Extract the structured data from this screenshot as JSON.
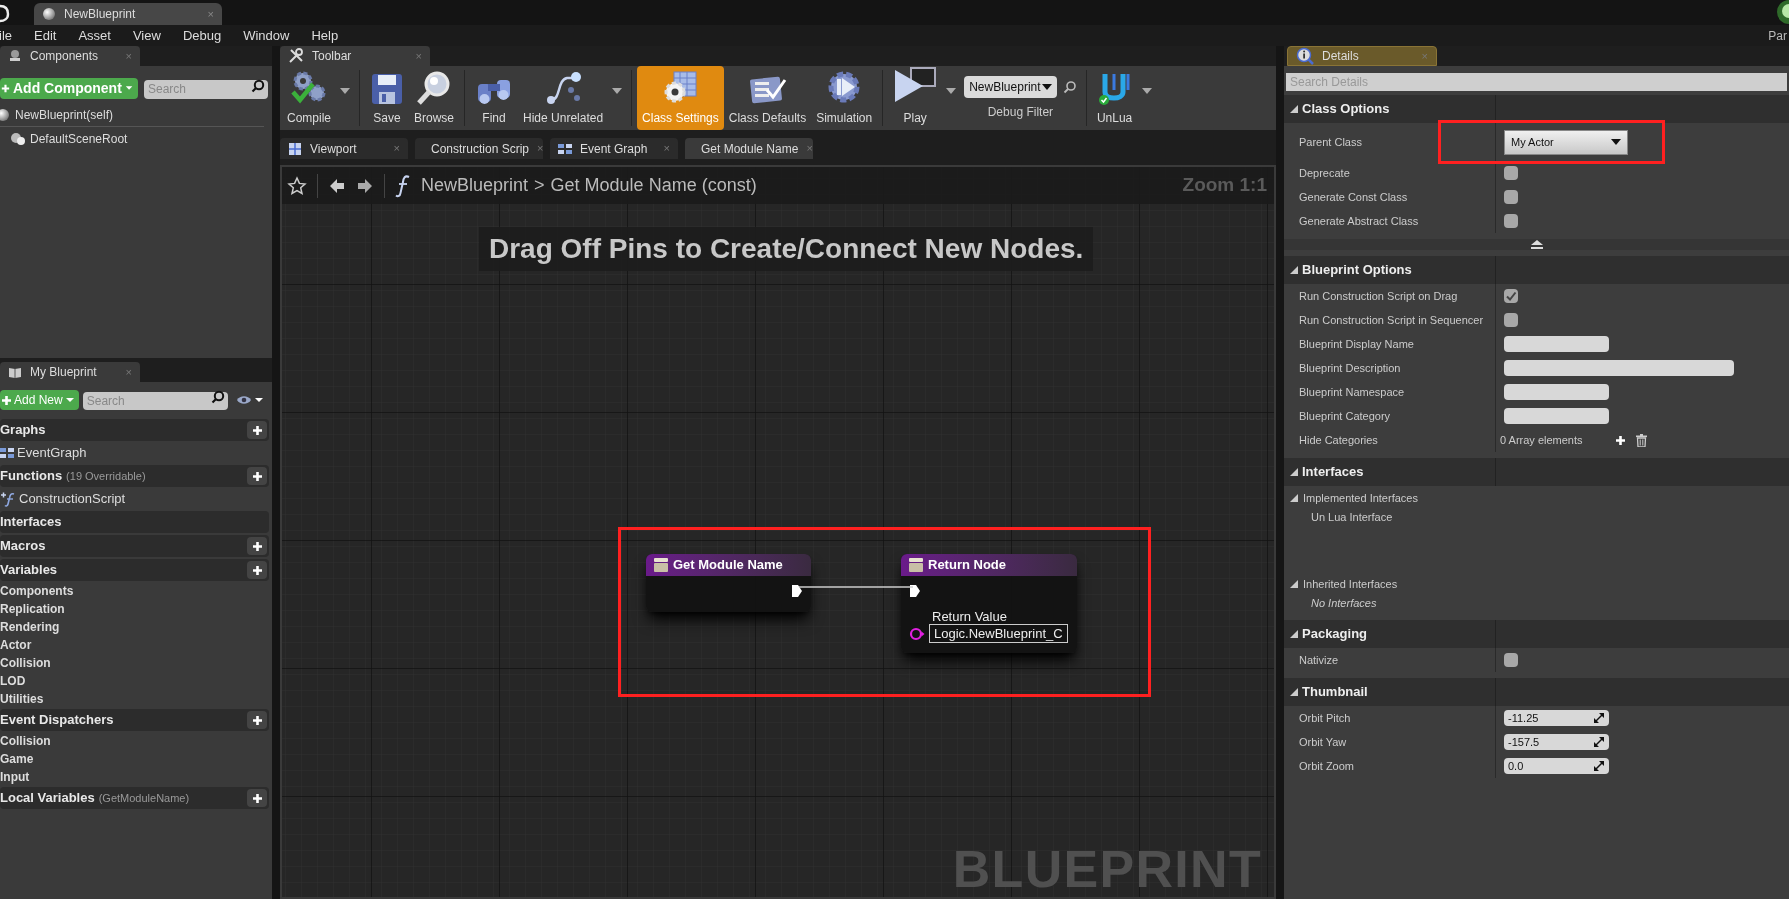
{
  "window": {
    "tab": "NewBlueprint",
    "close": "×",
    "corner_label": "Par"
  },
  "menu": [
    "ile",
    "Edit",
    "Asset",
    "View",
    "Debug",
    "Window",
    "Help"
  ],
  "components": {
    "tab": "Components",
    "close": "×",
    "add_button": "Add Component",
    "search": {
      "placeholder": "Search"
    },
    "tree": [
      {
        "label": "NewBlueprint(self)",
        "children": [
          {
            "label": "DefaultSceneRoot"
          }
        ]
      }
    ]
  },
  "toolbar": {
    "tab": "Toolbar",
    "close": "×",
    "groups": [
      [
        {
          "kind": "compile",
          "label": "Compile",
          "dropdown": true,
          "selected": false
        }
      ],
      [
        {
          "kind": "save",
          "label": "Save",
          "dropdown": false,
          "selected": false
        },
        {
          "kind": "browse",
          "label": "Browse",
          "dropdown": false,
          "selected": false
        }
      ],
      [
        {
          "kind": "find",
          "label": "Find",
          "dropdown": false,
          "selected": false
        },
        {
          "kind": "hide",
          "label": "Hide Unrelated",
          "dropdown": true,
          "selected": false
        }
      ],
      [
        {
          "kind": "settings",
          "label": "Class Settings",
          "dropdown": false,
          "selected": true
        },
        {
          "kind": "defaults",
          "label": "Class Defaults",
          "dropdown": false,
          "selected": false
        },
        {
          "kind": "simulation",
          "label": "Simulation",
          "dropdown": false,
          "selected": false
        }
      ],
      [
        {
          "kind": "play",
          "label": "Play",
          "dropdown": true,
          "selected": false
        },
        {
          "kind": "filter",
          "value": "NewBlueprint",
          "label": "Debug Filter"
        }
      ],
      [
        {
          "kind": "unlua",
          "label": "UnLua",
          "dropdown": true,
          "selected": false
        }
      ]
    ]
  },
  "doc_tabs": [
    {
      "kind": "viewport",
      "label": "Viewport",
      "close": "×",
      "selected": false
    },
    {
      "kind": "function",
      "label": "Construction Scrip",
      "close": "×",
      "selected": false
    },
    {
      "kind": "graph",
      "label": "Event Graph",
      "close": "×",
      "selected": false
    },
    {
      "kind": "function",
      "label": "Get Module Name",
      "close": "×",
      "selected": true
    }
  ],
  "graph": {
    "breadcrumb": [
      "NewBlueprint",
      "Get Module Name (const)"
    ],
    "separator": ">",
    "zoom": "Zoom 1:1",
    "hint": "Drag Off Pins to Create/Connect New Nodes.",
    "watermark": "BLUEPRINT",
    "nodes": [
      {
        "kind": "entry",
        "title": "Get Module Name"
      },
      {
        "kind": "result",
        "title": "Return Node",
        "pins": [
          {
            "label": "Return Value",
            "value": "Logic.NewBlueprint_C"
          }
        ]
      }
    ]
  },
  "my_blueprint": {
    "tab": "My Blueprint",
    "close": "×",
    "add_button": "Add New",
    "search": {
      "placeholder": "Search"
    },
    "sections": [
      {
        "title": "Graphs",
        "addable": true,
        "items": [
          {
            "kind": "graph",
            "label": "EventGraph"
          }
        ]
      },
      {
        "title": "Functions",
        "note": "(19 Overridable)",
        "addable": true,
        "items": [
          {
            "kind": "function",
            "label": "ConstructionScript"
          }
        ]
      },
      {
        "title": "Interfaces",
        "addable": false
      },
      {
        "title": "Macros",
        "addable": true
      },
      {
        "title": "Variables",
        "addable": true,
        "items": [
          {
            "kind": "category",
            "label": "Components"
          },
          {
            "kind": "category",
            "label": "Replication"
          },
          {
            "kind": "category",
            "label": "Rendering"
          },
          {
            "kind": "category",
            "label": "Actor"
          },
          {
            "kind": "category",
            "label": "Collision"
          },
          {
            "kind": "category",
            "label": "LOD"
          },
          {
            "kind": "category",
            "label": "Utilities"
          }
        ]
      },
      {
        "title": "Event Dispatchers",
        "addable": true,
        "items": [
          {
            "kind": "category",
            "label": "Collision"
          },
          {
            "kind": "category",
            "label": "Game"
          },
          {
            "kind": "category",
            "label": "Input"
          }
        ]
      },
      {
        "title": "Local Variables",
        "note": "(GetModuleName)",
        "addable": true
      }
    ]
  },
  "details": {
    "tab": "Details",
    "close": "×",
    "search": {
      "placeholder": "Search Details"
    },
    "categories": [
      {
        "title": "Class Options",
        "advanced_toggle": true,
        "rows": [
          {
            "kind": "dropdown",
            "label": "Parent Class",
            "value": "My Actor"
          },
          {
            "kind": "checkbox",
            "label": "Deprecate",
            "checked": false
          },
          {
            "kind": "checkbox",
            "label": "Generate Const Class",
            "checked": false
          },
          {
            "kind": "checkbox",
            "label": "Generate Abstract Class",
            "checked": false
          }
        ]
      },
      {
        "title": "Blueprint Options",
        "rows": [
          {
            "kind": "checkbox",
            "label": "Run Construction Script on Drag",
            "checked": true
          },
          {
            "kind": "checkbox",
            "label": "Run Construction Script in Sequencer",
            "checked": false
          },
          {
            "kind": "text",
            "label": "Blueprint Display Name"
          },
          {
            "kind": "longtext",
            "label": "Blueprint Description"
          },
          {
            "kind": "text",
            "label": "Blueprint Namespace"
          },
          {
            "kind": "text",
            "label": "Blueprint Category"
          },
          {
            "kind": "array",
            "label": "Hide Categories",
            "value": "0 Array elements"
          }
        ]
      },
      {
        "title": "Interfaces",
        "rows": [
          {
            "kind": "group",
            "label": "Implemented Interfaces",
            "children": [
              {
                "kind": "interface",
                "label": "Un Lua Interface"
              }
            ]
          },
          {
            "kind": "group",
            "label": "Inherited Interfaces",
            "children": [
              {
                "kind": "none",
                "label": "No Interfaces"
              }
            ]
          }
        ]
      },
      {
        "title": "Packaging",
        "rows": [
          {
            "kind": "checkbox",
            "label": "Nativize",
            "checked": false
          }
        ]
      },
      {
        "title": "Thumbnail",
        "rows": [
          {
            "kind": "number",
            "label": "Orbit Pitch",
            "value": "-11.25"
          },
          {
            "kind": "number",
            "label": "Orbit Yaw",
            "value": "-157.5"
          },
          {
            "kind": "number",
            "label": "Orbit Zoom",
            "value": "0.0"
          }
        ]
      }
    ]
  }
}
